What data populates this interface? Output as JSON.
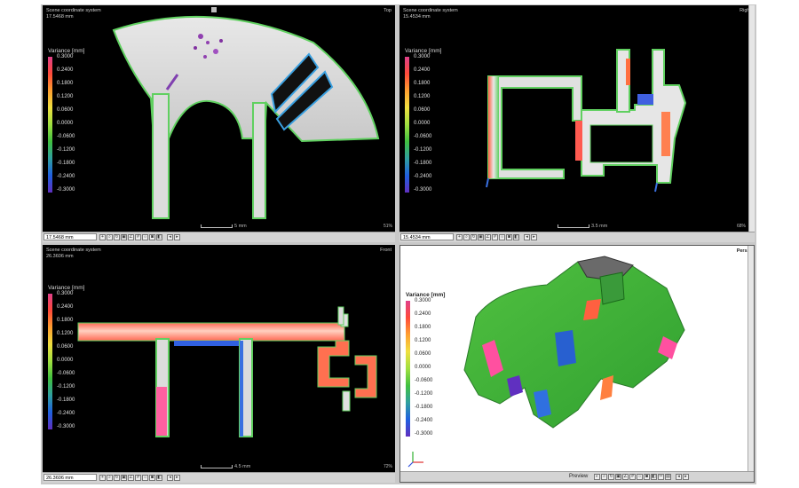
{
  "panes": {
    "top": {
      "system": "Scene coordinate system",
      "distance": "17.5468 mm",
      "view": "Top",
      "coord": "17.5468 mm",
      "scale": "5 mm",
      "corner": "51%"
    },
    "right": {
      "system": "Scene coordinate system",
      "distance": "15.4534 mm",
      "view": "Right",
      "coord": "15.4534 mm",
      "scale": "3.5 mm",
      "corner": "68%"
    },
    "front": {
      "system": "Scene coordinate system",
      "distance": "26.3606 mm",
      "view": "Front",
      "coord": "26.3606 mm",
      "scale": "4.5 mm",
      "corner": "72%"
    },
    "persp": {
      "view": "Persp",
      "preview_label": "Preview"
    }
  },
  "legend": {
    "title": "Variance [mm]",
    "ticks": [
      "0.3000",
      "0.2400",
      "0.1800",
      "0.1200",
      "0.0600",
      "0.0000",
      "-0.0600",
      "-0.1200",
      "-0.1800",
      "-0.2400",
      "-0.3000"
    ]
  },
  "colors": {
    "pink": "#e0408a",
    "red": "#ff4a3a",
    "green": "#40c040",
    "blue": "#2060e0",
    "purple": "#6030c0",
    "background": "#000000"
  }
}
